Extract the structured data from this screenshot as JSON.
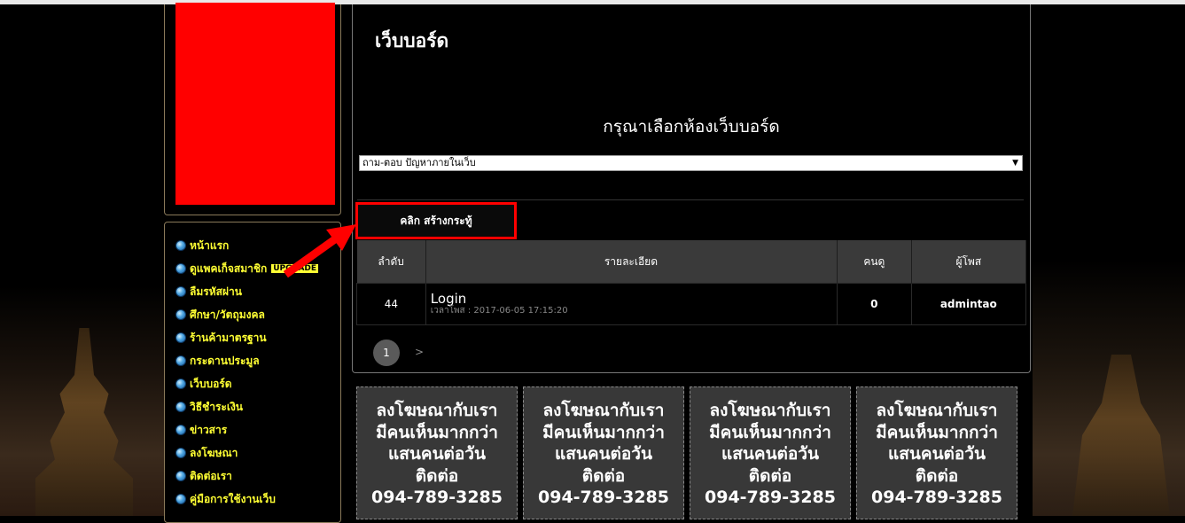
{
  "page_title": "เว็บบอร์ด",
  "choose_title": "กรุณาเลือกห้องเว็บบอร์ด",
  "room_select": {
    "selected": "ถาม-ตอบ ปัญหาภายในเว็บ"
  },
  "create_button": "คลิก สร้างกระทู้",
  "menu": {
    "items": [
      {
        "label": "หน้าแรก"
      },
      {
        "label": "ดูแพคเก็จสมาชิก",
        "badge": "UPGRADE"
      },
      {
        "label": "ลืมรหัสผ่าน"
      },
      {
        "label": "ศึกษา/วัตถุมงคล"
      },
      {
        "label": "ร้านค้ามาตรฐาน"
      },
      {
        "label": "กระดานประมูล"
      },
      {
        "label": "เว็บบอร์ด"
      },
      {
        "label": "วิธีชำระเงิน"
      },
      {
        "label": "ข่าวสาร"
      },
      {
        "label": "ลงโฆษณา"
      },
      {
        "label": "ติดต่อเรา"
      },
      {
        "label": "คู่มือการใช้งานเว็บ"
      }
    ]
  },
  "table": {
    "headers": {
      "no": "ลำดับ",
      "detail": "รายละเอียด",
      "views": "คนดู",
      "poster": "ผู้โพส"
    },
    "rows": [
      {
        "no": "44",
        "title": "Login",
        "time": "เวลาโพส : 2017-06-05 17:15:20",
        "views": "0",
        "poster": "admintao"
      }
    ]
  },
  "pager": {
    "current": "1",
    "next": ">"
  },
  "ad": {
    "line1": "ลงโฆษณากับเรา",
    "line2": "มีคนเห็นมากกว่า",
    "line3": "แสนคนต่อวัน",
    "line4": "ติดต่อ",
    "phone": "094-789-3285"
  },
  "colors": {
    "highlight": "#ff0000",
    "menu_text": "#ffff33",
    "table_header": "#3a3a3a"
  }
}
